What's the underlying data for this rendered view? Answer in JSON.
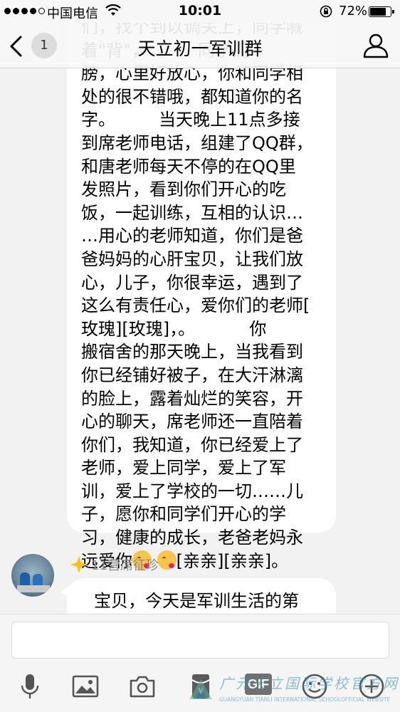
{
  "status_bar": {
    "carrier": "中国电信",
    "time": "10:01",
    "battery": "72%",
    "battery_level": 0.72
  },
  "nav": {
    "back_badge": "1",
    "title": "天立初一军训群",
    "back_icon": "chevron-left-icon",
    "profile_icon": "person-icon"
  },
  "messages": {
    "first": {
      "text_top": "们，找个到以调关上，同学喊\n着\"背\"，  。    同学们\n膀，心里好放心，你和同学相\n",
      "text": "处的很不错哦，都知道你的名\n字。        当天晚上11点多接\n到席老师电话，组建了QQ群，\n和唐老师每天不停的在QQ里\n发照片，看到你们开心的吃\n饭，一起训练，互相的认识…\n…用心的老师知道，你们是爸\n爸妈妈的心肝宝贝，让我们放\n心，儿子，你很幸运，遇到了\n这么有责任心，爱你们的老师[\n玫瑰][玫瑰]，。          你\n搬宿舍的那天晚上，当我看到\n你已经铺好被子，在大汗淋漓\n的脸上，露着灿烂的笑容，开\n心的聊天，席老师还一直陪着\n你们，我知道，你已经爱上了\n老师，爱上同学，爱上了军\n训，爱上了学校的一切……儿\n子，愿你和同学们开心的学\n习，健康的成长，老爸老妈永\n远爱你",
      "text_tail": "[亲亲][亲亲]。"
    },
    "second": {
      "sender": "11营席征珍",
      "text": "宝贝，今天是军训生活的第"
    }
  },
  "input": {
    "placeholder": ""
  },
  "toolbar": {
    "items": [
      "microphone-icon",
      "image-icon",
      "camera-icon",
      "red-packet-icon",
      "gif-icon",
      "emoji-icon",
      "plus-icon"
    ],
    "gif_label": "GIF"
  },
  "watermark": {
    "cn": "广元天立国际学校官方网站",
    "en": "GUANGYUAN TIANLI INTERNATIONAL SCHOOLOFFICIAL WEBSITE"
  },
  "colors": {
    "accent": "#1aad19",
    "bubble": "#ffffff",
    "background": "#f2f2f2"
  }
}
